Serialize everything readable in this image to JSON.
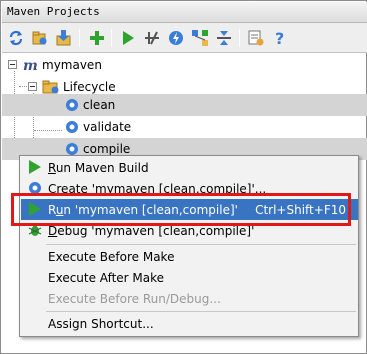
{
  "window": {
    "title": "Maven Projects"
  },
  "toolbar": {
    "buttons": [
      "reimport-icon",
      "generate-sources-icon",
      "download-icon",
      "add-icon",
      "run-icon",
      "toggle-offline-icon",
      "skip-tests-icon",
      "show-dependencies-icon",
      "collapse-all-icon",
      "settings-icon",
      "help-icon"
    ]
  },
  "tree": {
    "project": "mymaven",
    "lifecycle": "Lifecycle",
    "goals": [
      "clean",
      "validate",
      "compile"
    ]
  },
  "menu": {
    "items": [
      {
        "label_pre": "",
        "mnemonic": "R",
        "label_post": "un Maven Build",
        "shortcut": "",
        "icon": "run-icon"
      },
      {
        "label_pre": "",
        "mnemonic": "C",
        "label_post": "reate 'mymaven [clean,compile]'...",
        "shortcut": "",
        "icon": "gear-icon"
      },
      {
        "label_pre": "R",
        "mnemonic": "u",
        "label_post": "n 'mymaven [clean,compile]'",
        "shortcut": "Ctrl+Shift+F10",
        "icon": "run-icon"
      },
      {
        "label_pre": "",
        "mnemonic": "D",
        "label_post": "ebug 'mymaven [clean,compile]'",
        "shortcut": "",
        "icon": "debug-icon"
      },
      {
        "label": "Execute Before Make"
      },
      {
        "label": "Execute After Make"
      },
      {
        "label": "Execute Before Run/Debug..."
      },
      {
        "label": "Assign Shortcut..."
      }
    ]
  },
  "colors": {
    "highlight": "#3974c2",
    "annotation": "#e01818",
    "run_green": "#2fa32f",
    "gear_blue": "#3b7dd8"
  }
}
